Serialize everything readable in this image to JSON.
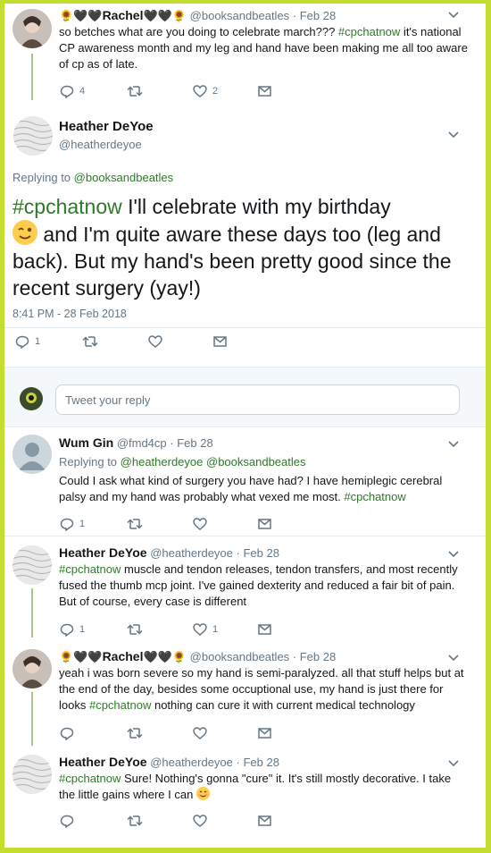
{
  "tweets": [
    {
      "name_prefix": "🌻🖤🖤",
      "name": "Rachel",
      "name_suffix": "🖤🖤🌻",
      "handle": "@booksandbeatles",
      "time": "Feb 28",
      "text_a": "so betches what are you doing to celebrate march??? ",
      "tag": "#cpchatnow",
      "text_b": " it's national CP awareness month and my leg and hand have been making me all too aware of cp as of late.",
      "replies": "4",
      "likes": "2"
    }
  ],
  "focus": {
    "name": "Heather DeYoe",
    "handle": "@heatherdeyoe",
    "replying_label": "Replying to ",
    "replying_to": "@booksandbeatles",
    "tag": "#cpchatnow",
    "text_a": " I'll celebrate with my birthday",
    "text_b": " and I'm quite aware these days too (leg and back). But my hand's been pretty good since the recent surgery (yay!)",
    "timestamp": "8:41 PM - 28 Feb 2018",
    "replies": "1"
  },
  "reply_box": {
    "placeholder": "Tweet your reply"
  },
  "replies": [
    {
      "name": "Wum Gin",
      "handle": "@fmd4cp",
      "time": "Feb 28",
      "replying_label": "Replying to ",
      "replying_to_1": "@heatherdeyoe",
      "replying_to_2": "@booksandbeatles",
      "text_a": "Could I ask what kind of surgery you have had? I have hemiplegic cerebral palsy and my hand was probably what vexed me most. ",
      "tag": "#cpchatnow",
      "replies": "1"
    },
    {
      "name": "Heather DeYoe",
      "handle": "@heatherdeyoe",
      "time": "Feb 28",
      "tag": "#cpchatnow",
      "text_a": " muscle and tendon releases, tendon transfers, and most recently fused the thumb mcp joint. I've gained  dexterity and reduced a fair bit of pain. But of course, every case is different",
      "replies": "1",
      "likes": "1"
    },
    {
      "name_prefix": "🌻🖤🖤",
      "name": "Rachel",
      "name_suffix": "🖤🖤🌻",
      "handle": "@booksandbeatles",
      "time": "Feb 28",
      "text_a": "yeah i was born severe so my hand is semi-paralyzed. all that stuff helps but at the end of the day, besides some occuptional use, my hand is just there for looks ",
      "tag": "#cpchatnow",
      "text_b": " nothing can cure it with current medical technology"
    },
    {
      "name": "Heather DeYoe",
      "handle": "@heatherdeyoe",
      "time": "Feb 28",
      "tag": "#cpchatnow",
      "text_a": " Sure! Nothing's gonna \"cure\" it. It's still mostly decorative. I take the little gains where I can"
    }
  ],
  "colors": {
    "frame": "#c3de2e",
    "link": "#2f7a2a",
    "muted": "#657786",
    "thread": "#a8c58c"
  },
  "icons": [
    "reply-icon",
    "retweet-icon",
    "like-icon",
    "message-icon",
    "chevron-down-icon"
  ]
}
